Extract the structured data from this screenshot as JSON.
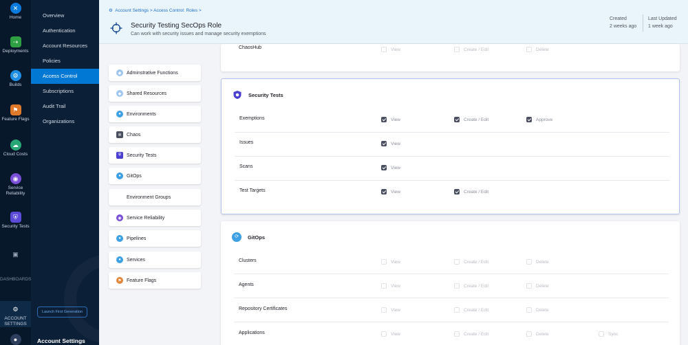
{
  "rail": [
    {
      "label": "Home",
      "icon": "harness-logo-icon",
      "color": "#0a7bde"
    },
    {
      "label": "Deployments",
      "icon": "deployments-icon",
      "color": "#2ea043"
    },
    {
      "label": "Builds",
      "icon": "builds-icon",
      "color": "#1f8fe5"
    },
    {
      "label": "Feature Flags",
      "icon": "feature-flags-icon",
      "color": "#e07a2b"
    },
    {
      "label": "Cloud Costs",
      "icon": "cloud-costs-icon",
      "color": "#2aa776"
    },
    {
      "label": "Service Reliability",
      "icon": "service-reliability-icon",
      "color": "#7a4fd8"
    },
    {
      "label": "Security Tests",
      "icon": "security-tests-icon",
      "color": "#5b4bd8"
    },
    {
      "label": "",
      "icon": "chat-icon",
      "color": "#9aa6b8"
    },
    {
      "label": "DASHBOARDS",
      "icon": "dashboards-icon",
      "color": "#9aa6b8"
    },
    {
      "label": "ACCOUNT SETTINGS",
      "icon": "account-settings-icon",
      "color": "#ffffff"
    }
  ],
  "nav2": {
    "items": [
      "Overview",
      "Authentication",
      "Account Resources",
      "Policies",
      "Access Control",
      "Subscriptions",
      "Audit Trail",
      "Organizations"
    ],
    "active_index": 4,
    "launch_label": "Launch First Generation",
    "bottom_title": "Account Settings"
  },
  "header": {
    "crumbs": [
      "Account Settings",
      "Access Control: Roles"
    ],
    "title": "Security Testing SecOps Role",
    "description": "Can work with security issues and manage security exemptions",
    "created_label": "Created",
    "created_value": "2 weeks ago",
    "updated_label": "Last Updated",
    "updated_value": "1 week ago"
  },
  "categories": [
    {
      "label": "Adminstrative Functions",
      "icon": "admin-functions-icon",
      "color": "#9fc7ee"
    },
    {
      "label": "Shared Resources",
      "icon": "shared-resources-icon",
      "color": "#9fc7ee"
    },
    {
      "label": "Environments",
      "icon": "environments-icon",
      "color": "#3ea0e4"
    },
    {
      "label": "Chaos",
      "icon": "chaos-icon",
      "color": "#4b5061"
    },
    {
      "label": "Security Tests",
      "icon": "security-tests-icon",
      "color": "#4b3fd1"
    },
    {
      "label": "GitOps",
      "icon": "gitops-icon",
      "color": "#3ea0e4"
    },
    {
      "label": "Environment Groups",
      "icon": "",
      "color": ""
    },
    {
      "label": "Service Reliability",
      "icon": "service-reliability-icon",
      "color": "#7a4fd8"
    },
    {
      "label": "Pipelines",
      "icon": "pipelines-icon",
      "color": "#3ea0e4"
    },
    {
      "label": "Services",
      "icon": "services-icon",
      "color": "#3ea0e4"
    },
    {
      "label": "Feature Flags",
      "icon": "feature-flags-icon",
      "color": "#e0883c"
    }
  ],
  "chaos_card": {
    "partial_label": "ChaosHub",
    "perms": [
      {
        "label": "View",
        "checked": false
      },
      {
        "label": "Create / Edit",
        "checked": false
      },
      {
        "label": "Delete",
        "checked": false
      }
    ]
  },
  "security_card": {
    "title": "Security Tests",
    "rows": [
      {
        "label": "Exemptions",
        "perms": [
          {
            "label": "View",
            "checked": true
          },
          {
            "label": "Create / Edit",
            "checked": true
          },
          {
            "label": "Approve",
            "checked": true
          }
        ]
      },
      {
        "label": "Issues",
        "perms": [
          {
            "label": "View",
            "checked": true
          }
        ]
      },
      {
        "label": "Scans",
        "perms": [
          {
            "label": "View",
            "checked": true
          }
        ]
      },
      {
        "label": "Test Targets",
        "perms": [
          {
            "label": "View",
            "checked": true
          },
          {
            "label": "Create / Edit",
            "checked": true
          }
        ]
      }
    ]
  },
  "gitops_card": {
    "title": "GitOps",
    "rows": [
      {
        "label": "Clusters",
        "perms": [
          {
            "label": "View",
            "checked": false
          },
          {
            "label": "Create / Edit",
            "checked": false
          },
          {
            "label": "Delete",
            "checked": false
          }
        ]
      },
      {
        "label": "Agents",
        "perms": [
          {
            "label": "View",
            "checked": false
          },
          {
            "label": "Create / Edit",
            "checked": false
          },
          {
            "label": "Delete",
            "checked": false
          }
        ]
      },
      {
        "label": "Repository Certificates",
        "perms": [
          {
            "label": "View",
            "checked": false
          },
          {
            "label": "Create / Edit",
            "checked": false
          },
          {
            "label": "Delete",
            "checked": false
          }
        ]
      },
      {
        "label": "Applications",
        "perms": [
          {
            "label": "View",
            "checked": false
          },
          {
            "label": "Create / Edit",
            "checked": false
          },
          {
            "label": "Delete",
            "checked": false
          },
          {
            "label": "Sync",
            "checked": false
          }
        ]
      }
    ]
  }
}
